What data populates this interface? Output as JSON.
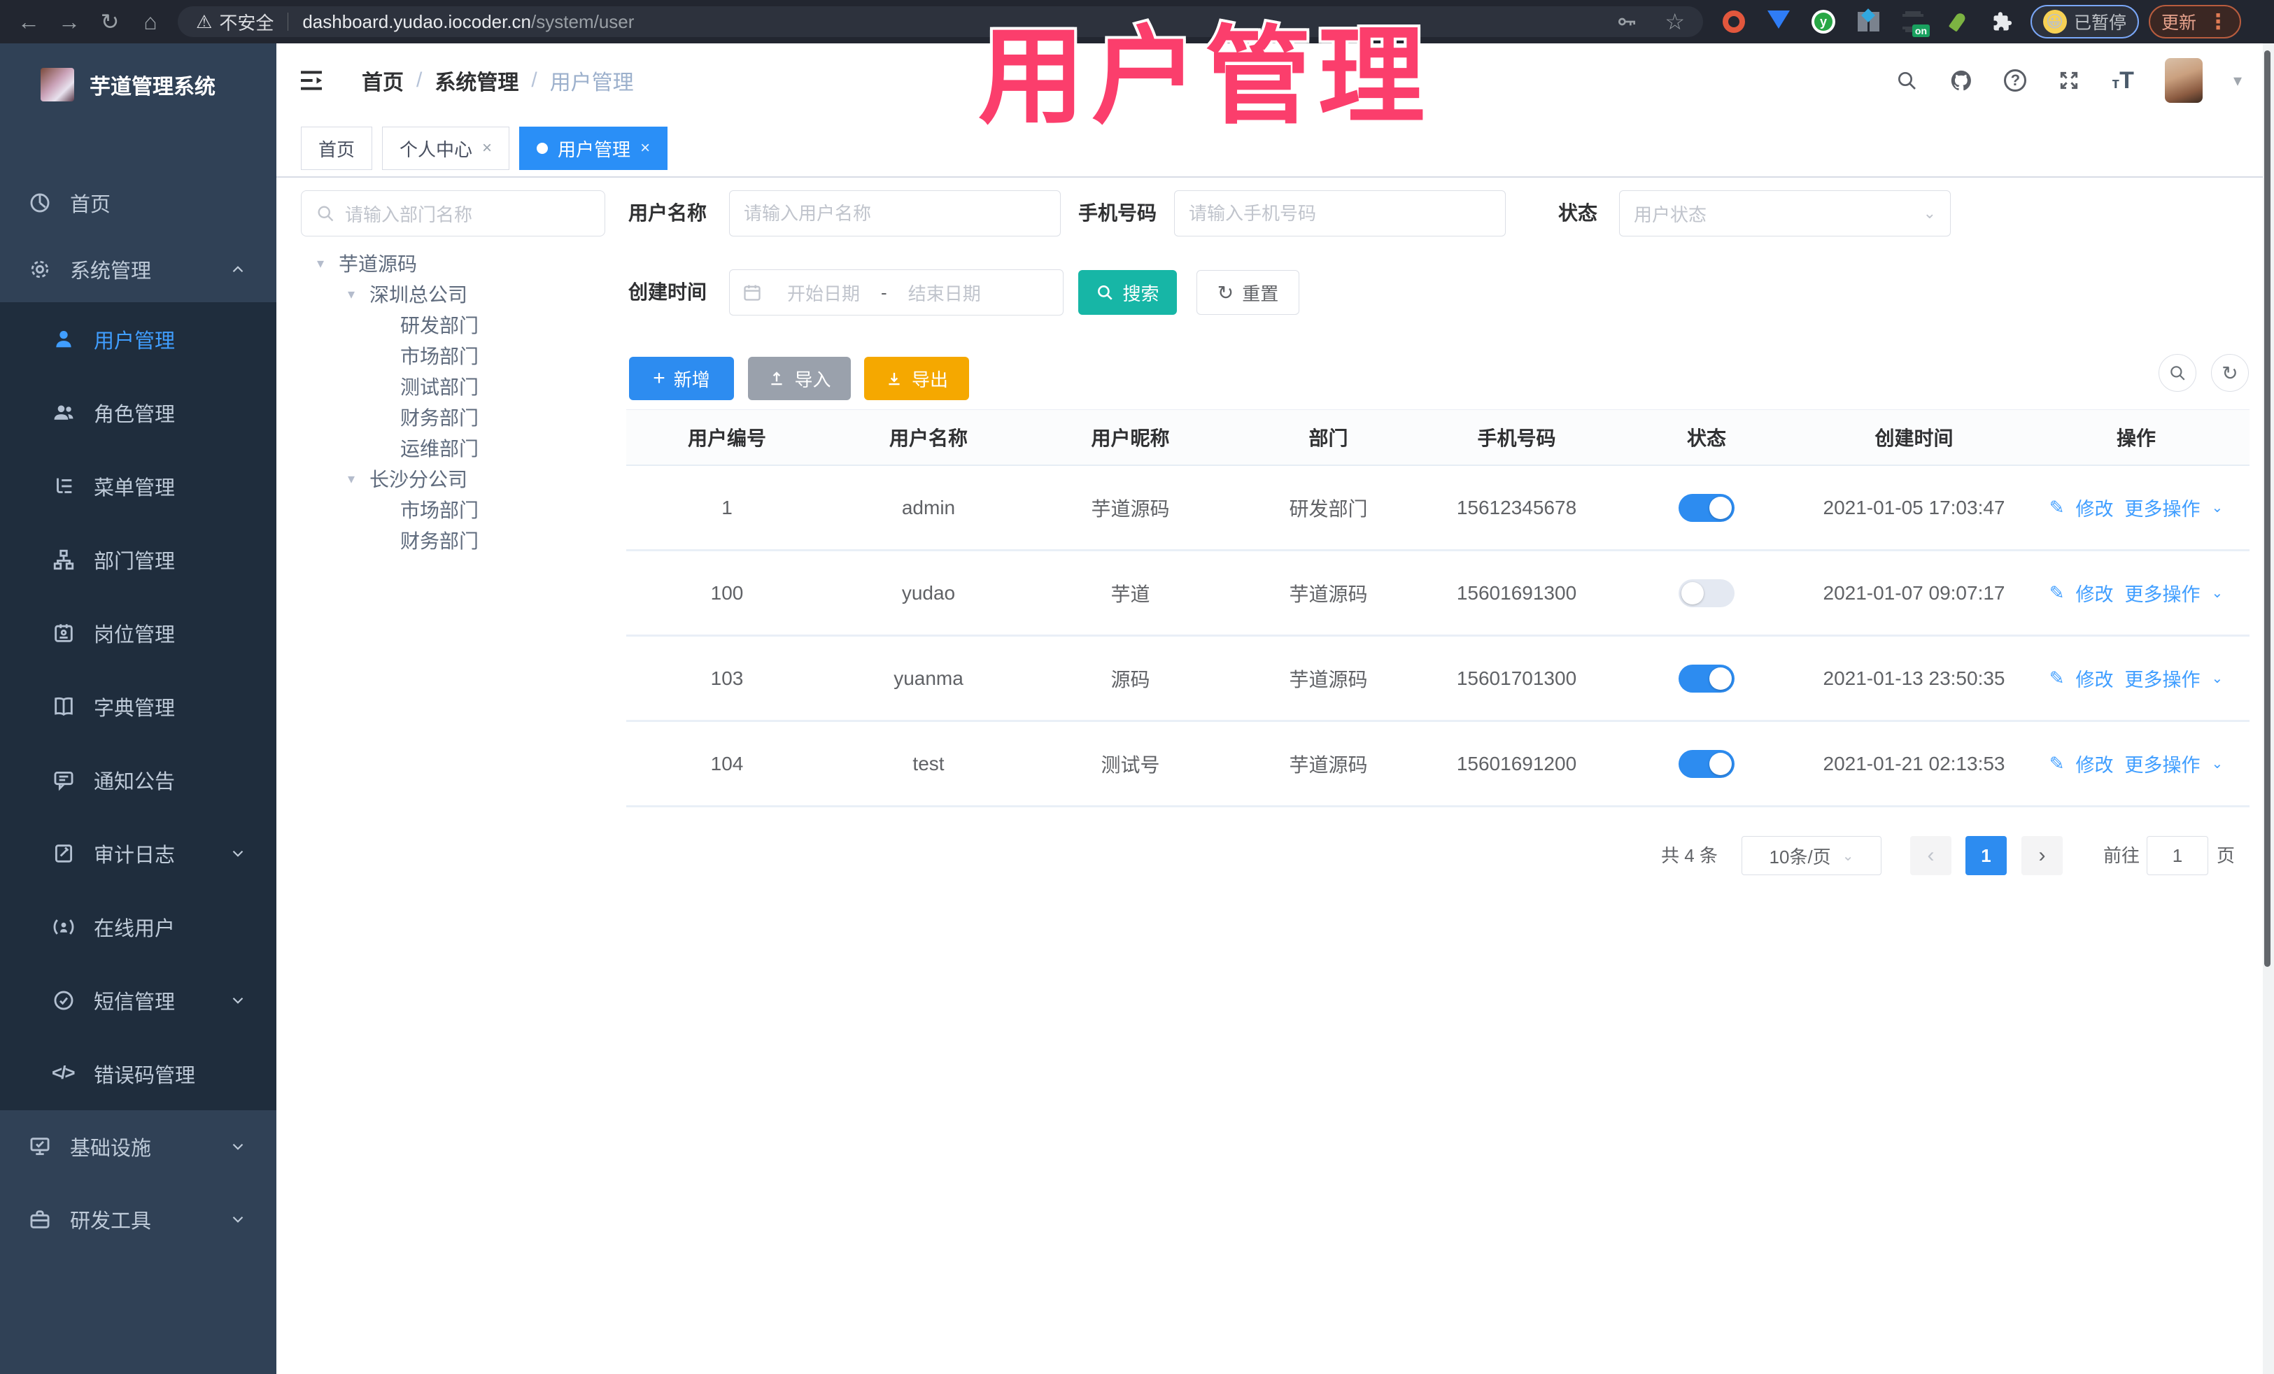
{
  "browser": {
    "security_label": "不安全",
    "url_host": "dashboard.yudao.iocoder.cn",
    "url_path": "/system/user",
    "profile_badge": "已暂停",
    "update_label": "更新",
    "menu_dots": "⋮"
  },
  "annotation": {
    "text": "用户管理",
    "color": "#fb3e6c"
  },
  "sidebar": {
    "logo_title": "芋道管理系统",
    "items": [
      {
        "label": "首页",
        "icon": "dashboard-icon"
      },
      {
        "label": "系统管理",
        "icon": "gear-icon",
        "expanded": true
      },
      {
        "label": "用户管理",
        "icon": "user-icon",
        "active": true
      },
      {
        "label": "角色管理",
        "icon": "users-icon"
      },
      {
        "label": "菜单管理",
        "icon": "menu-tree-icon"
      },
      {
        "label": "部门管理",
        "icon": "org-icon"
      },
      {
        "label": "岗位管理",
        "icon": "badge-icon"
      },
      {
        "label": "字典管理",
        "icon": "book-icon"
      },
      {
        "label": "通知公告",
        "icon": "announcement-icon"
      },
      {
        "label": "审计日志",
        "icon": "log-icon",
        "collapsible": true
      },
      {
        "label": "在线用户",
        "icon": "online-icon"
      },
      {
        "label": "短信管理",
        "icon": "sms-icon",
        "collapsible": true
      },
      {
        "label": "错误码管理",
        "icon": "code-icon"
      },
      {
        "label": "基础设施",
        "icon": "infra-icon",
        "collapsible": true
      },
      {
        "label": "研发工具",
        "icon": "tools-icon",
        "collapsible": true
      }
    ]
  },
  "header": {
    "breadcrumb": [
      "首页",
      "系统管理",
      "用户管理"
    ]
  },
  "tabs": [
    {
      "label": "首页",
      "closable": false,
      "active": false
    },
    {
      "label": "个人中心",
      "closable": true,
      "active": false
    },
    {
      "label": "用户管理",
      "closable": true,
      "active": true
    }
  ],
  "tree": {
    "search_placeholder": "请输入部门名称",
    "nodes": [
      {
        "label": "芋道源码",
        "level": 0,
        "expanded": true
      },
      {
        "label": "深圳总公司",
        "level": 1,
        "expanded": true
      },
      {
        "label": "研发部门",
        "level": 2
      },
      {
        "label": "市场部门",
        "level": 2
      },
      {
        "label": "测试部门",
        "level": 2
      },
      {
        "label": "财务部门",
        "level": 2
      },
      {
        "label": "运维部门",
        "level": 2
      },
      {
        "label": "长沙分公司",
        "level": 1,
        "expanded": true
      },
      {
        "label": "市场部门",
        "level": 2
      },
      {
        "label": "财务部门",
        "level": 2
      }
    ]
  },
  "filters": {
    "username_label": "用户名称",
    "username_placeholder": "请输入用户名称",
    "mobile_label": "手机号码",
    "mobile_placeholder": "请输入手机号码",
    "status_label": "状态",
    "status_placeholder": "用户状态",
    "time_label": "创建时间",
    "date_start": "开始日期",
    "date_separator": "-",
    "date_end": "结束日期",
    "search_label": "搜索",
    "reset_label": "重置"
  },
  "toolbar": {
    "add_label": "新增",
    "import_label": "导入",
    "export_label": "导出"
  },
  "table": {
    "columns": [
      "用户编号",
      "用户名称",
      "用户昵称",
      "部门",
      "手机号码",
      "状态",
      "创建时间",
      "操作"
    ],
    "row_actions": {
      "edit": "修改",
      "more": "更多操作"
    },
    "rows": [
      {
        "id": "1",
        "username": "admin",
        "nickname": "芋道源码",
        "dept": "研发部门",
        "mobile": "15612345678",
        "status": "on",
        "created": "2021-01-05 17:03:47"
      },
      {
        "id": "100",
        "username": "yudao",
        "nickname": "芋道",
        "dept": "芋道源码",
        "mobile": "15601691300",
        "status": "off",
        "created": "2021-01-07 09:07:17"
      },
      {
        "id": "103",
        "username": "yuanma",
        "nickname": "源码",
        "dept": "芋道源码",
        "mobile": "15601701300",
        "status": "on",
        "created": "2021-01-13 23:50:35"
      },
      {
        "id": "104",
        "username": "test",
        "nickname": "测试号",
        "dept": "芋道源码",
        "mobile": "15601691200",
        "status": "on",
        "created": "2021-01-21 02:13:53"
      }
    ]
  },
  "pagination": {
    "total": "共 4 条",
    "page_size": "10条/页",
    "prev": "‹",
    "current_page": "1",
    "next": "›",
    "goto_label": "前往",
    "goto_value": "1",
    "page_unit": "页"
  },
  "colors": {
    "primary": "#409eff",
    "search_teal": "#17b6a6",
    "export_amber": "#f5a800",
    "sidebar_bg": "#304156",
    "submenu_bg": "#1f2d3d",
    "annotation_pink": "#fb3e6c"
  }
}
